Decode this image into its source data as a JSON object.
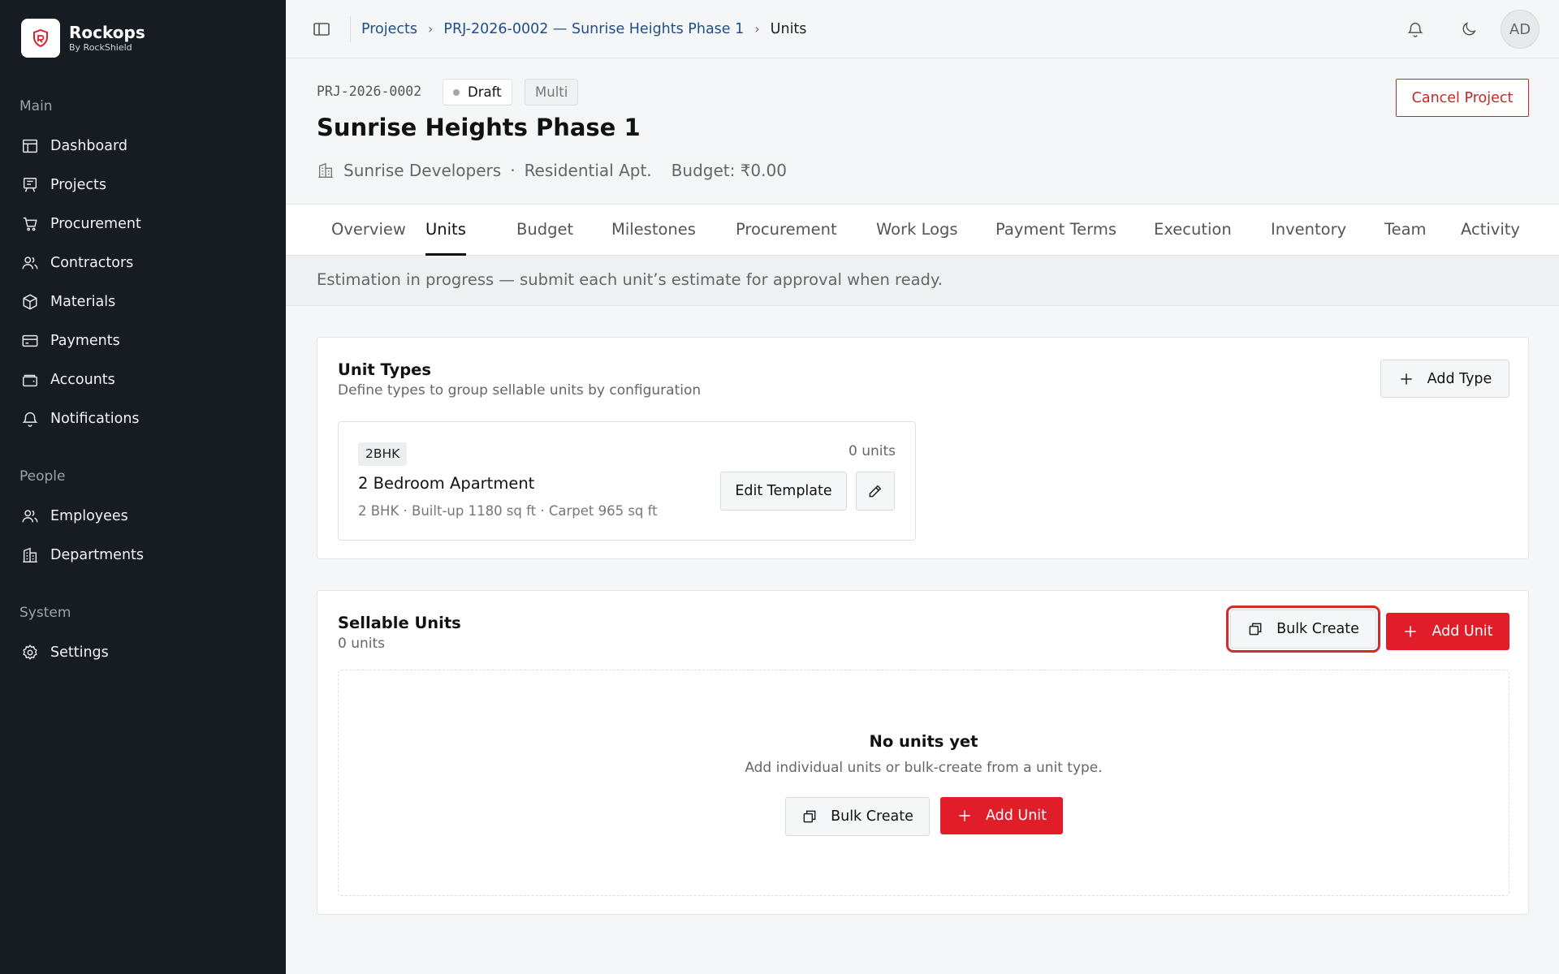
{
  "brand": {
    "name": "Rockops",
    "subtitle": "By RockShield",
    "logo_icon": "rockshield-logo-icon",
    "accent": "#e11d2a"
  },
  "sidebar": {
    "sections": [
      {
        "label": "Main"
      },
      {
        "label": "People"
      },
      {
        "label": "System"
      }
    ],
    "items": [
      {
        "label": "Dashboard",
        "icon": "dashboard-icon"
      },
      {
        "label": "Projects",
        "icon": "projects-icon"
      },
      {
        "label": "Procurement",
        "icon": "cart-icon"
      },
      {
        "label": "Contractors",
        "icon": "users-icon"
      },
      {
        "label": "Materials",
        "icon": "box-icon"
      },
      {
        "label": "Payments",
        "icon": "card-icon"
      },
      {
        "label": "Accounts",
        "icon": "wallet-icon"
      },
      {
        "label": "Notifications",
        "icon": "bell-icon"
      },
      {
        "label": "Employees",
        "icon": "users-icon"
      },
      {
        "label": "Departments",
        "icon": "building-icon"
      },
      {
        "label": "Settings",
        "icon": "gear-icon"
      }
    ]
  },
  "topbar": {
    "breadcrumbs": [
      "Projects",
      "PRJ-2026-0002 — Sunrise Heights Phase 1",
      "Units"
    ],
    "user_initials": "AD"
  },
  "project": {
    "code": "PRJ-2026-0002",
    "status": "Draft",
    "mode": "Multi",
    "title": "Sunrise Heights Phase 1",
    "developer": "Sunrise Developers",
    "category": "Residential Apt.",
    "budget": "Budget: ₹0.00",
    "cancel_label": "Cancel Project"
  },
  "tabs": [
    "Overview",
    "Units",
    "Budget",
    "Milestones",
    "Procurement",
    "Work Logs",
    "Payment Terms",
    "Execution",
    "Inventory",
    "Team",
    "Activity"
  ],
  "active_tab": "Units",
  "notice": "Estimation in progress — submit each unit’s estimate for approval when ready.",
  "unit_types": {
    "title": "Unit Types",
    "subtitle": "Define types to group sellable units by configuration",
    "add_label": "Add Type",
    "items": [
      {
        "code": "2BHK",
        "count": "0 units",
        "name": "2 Bedroom Apartment",
        "specs": "2 BHK · Built-up 1180 sq ft · Carpet 965 sq ft",
        "edit_template_label": "Edit Template"
      }
    ]
  },
  "sellable_units": {
    "title": "Sellable Units",
    "count": "0 units",
    "bulk_label": "Bulk Create",
    "add_label": "Add Unit",
    "empty_title": "No units yet",
    "empty_sub": "Add individual units or bulk-create from a unit type.",
    "empty_bulk_label": "Bulk Create",
    "empty_add_label": "Add Unit"
  }
}
